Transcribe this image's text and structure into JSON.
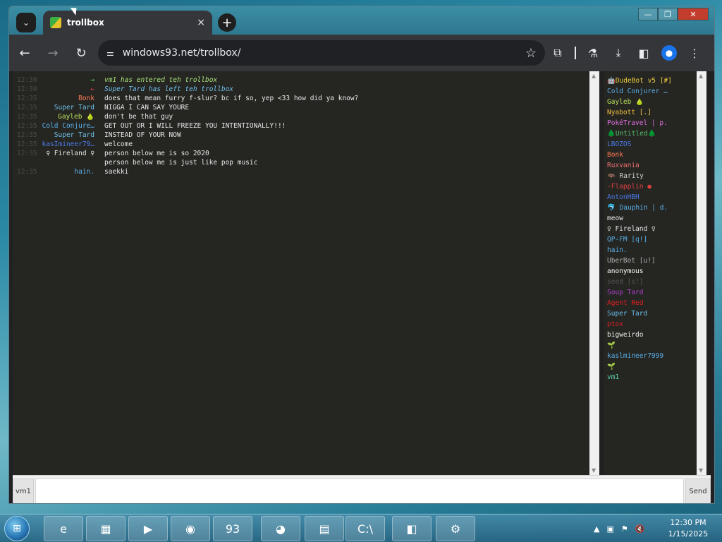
{
  "browser": {
    "tab_title": "trollbox",
    "url": "windows93.net/trollbox/",
    "tab_search_icon": "chevron-down-icon",
    "new_tab_label": "+",
    "close_tab_label": "×",
    "window_controls": [
      "—",
      "❐",
      "✕"
    ]
  },
  "chat": {
    "messages": [
      {
        "time": "12:30",
        "nick": "→",
        "nick_color": "#59d659",
        "text": "vm1 has entered teh trollbox",
        "text_color": "#a8e07a",
        "system": true
      },
      {
        "time": "12:30",
        "nick": "←",
        "nick_color": "#e0405a",
        "text": "Super Tard has left teh trollbox",
        "text_color": "#6ec0e8",
        "system": true
      },
      {
        "time": "12:35",
        "nick": "Bonk",
        "nick_color": "#ff7a59",
        "text": "does that mean furry f-slur? bc if so, yep <33 how did ya know?",
        "system": false
      },
      {
        "time": "12:35",
        "nick": "Super Tard",
        "nick_color": "#6ec0e8",
        "text": "NIGGA I CAN SAY YOURE",
        "system": false
      },
      {
        "time": "12:35",
        "nick": "Gayleb 🍐",
        "nick_color": "#b8e05a",
        "text": "don't be that guy",
        "system": false
      },
      {
        "time": "12:35",
        "nick": "Cold Conjure…",
        "nick_color": "#5ab0e8",
        "text": "GET OUT OR I WILL FREEZE YOU INTENTIONALLY!!!",
        "system": false
      },
      {
        "time": "12:35",
        "nick": "Super Tard",
        "nick_color": "#6ec0e8",
        "text": "INSTEAD OF YOUR NOW",
        "system": false
      },
      {
        "time": "12:35",
        "nick": "kasImineer79…",
        "nick_color": "#4a7ae8",
        "text": "welcome",
        "system": false
      },
      {
        "time": "12:35",
        "nick": "♀ Fireland ♀",
        "nick_color": "#e8e8e8",
        "text": "person below me is so 2020",
        "system": false
      },
      {
        "time": "",
        "nick": "",
        "nick_color": "#e8e8e8",
        "text": "person below me is just like pop music",
        "system": false
      },
      {
        "time": "12:35",
        "nick": "hain.",
        "nick_color": "#5ab0e8",
        "text": "saekki",
        "system": false
      }
    ]
  },
  "users": [
    {
      "name": "🤖DudeBot v5 [#]",
      "color": "#f0d040"
    },
    {
      "name": "Cold Conjurer …",
      "color": "#5ab0e8"
    },
    {
      "name": "Gayleb 🍐",
      "color": "#b8e05a"
    },
    {
      "name": "Nyabott [.]",
      "color": "#f0c040"
    },
    {
      "name": "PokéTravel | p.",
      "color": "#e070e0"
    },
    {
      "name": "🌲Untitled🌲",
      "color": "#59c06a"
    },
    {
      "name": "LBOZOS",
      "color": "#4a7ae8"
    },
    {
      "name": "Bonk",
      "color": "#ff7a59"
    },
    {
      "name": "Ruxvania",
      "color": "#f07070"
    },
    {
      "name": "🦇 Rarity",
      "color": "#d0d0d0"
    },
    {
      "name": "-Flapplin ●",
      "color": "#e04040"
    },
    {
      "name": "AntonHBH",
      "color": "#4a7ae8"
    },
    {
      "name": "🐬 Dauphin | d.",
      "color": "#5ab0e8"
    },
    {
      "name": "meow",
      "color": "#e8e8e8"
    },
    {
      "name": "♀ Fireland ♀",
      "color": "#e8e8e8"
    },
    {
      "name": "QP-FM [q!]",
      "color": "#5ab0e8"
    },
    {
      "name": "hain.",
      "color": "#5ab0e8"
    },
    {
      "name": "UberBot [u!]",
      "color": "#b0b0b0"
    },
    {
      "name": "anonymous",
      "color": "#ffffff"
    },
    {
      "name": "seed [s!]",
      "color": "#555555"
    },
    {
      "name": "Soup Tard",
      "color": "#b040d0"
    },
    {
      "name": "Agent Red",
      "color": "#e02020"
    },
    {
      "name": "Super Tard",
      "color": "#6ec0e8"
    },
    {
      "name": "ptox",
      "color": "#e02020"
    },
    {
      "name": "bigweirdo",
      "color": "#e8e8e8"
    },
    {
      "name": "🌱",
      "color": "#59c06a"
    },
    {
      "name": "kaslmineer7999",
      "color": "#5ab0e8"
    },
    {
      "name": "🌱",
      "color": "#59c06a"
    },
    {
      "name": "vm1",
      "color": "#59d6b0"
    }
  ],
  "input": {
    "nick": "vm1",
    "value": "",
    "send_label": "Send"
  },
  "taskbar": {
    "time": "12:30 PM",
    "date": "1/15/2025",
    "apps": [
      {
        "icon": "ie-icon",
        "glyph": "e"
      },
      {
        "icon": "folder-icon",
        "glyph": "▦"
      },
      {
        "icon": "media-player-icon",
        "glyph": "▶"
      },
      {
        "icon": "browser-icon",
        "glyph": "◉"
      },
      {
        "icon": "win93-icon",
        "glyph": "93"
      },
      {
        "icon": "discord-icon",
        "glyph": "◕"
      },
      {
        "icon": "task-manager-icon",
        "glyph": "▤"
      },
      {
        "icon": "cmd-icon",
        "glyph": "C:\\"
      },
      {
        "icon": "network-icon",
        "glyph": "◧"
      },
      {
        "icon": "tools-icon",
        "glyph": "⚙"
      }
    ]
  }
}
